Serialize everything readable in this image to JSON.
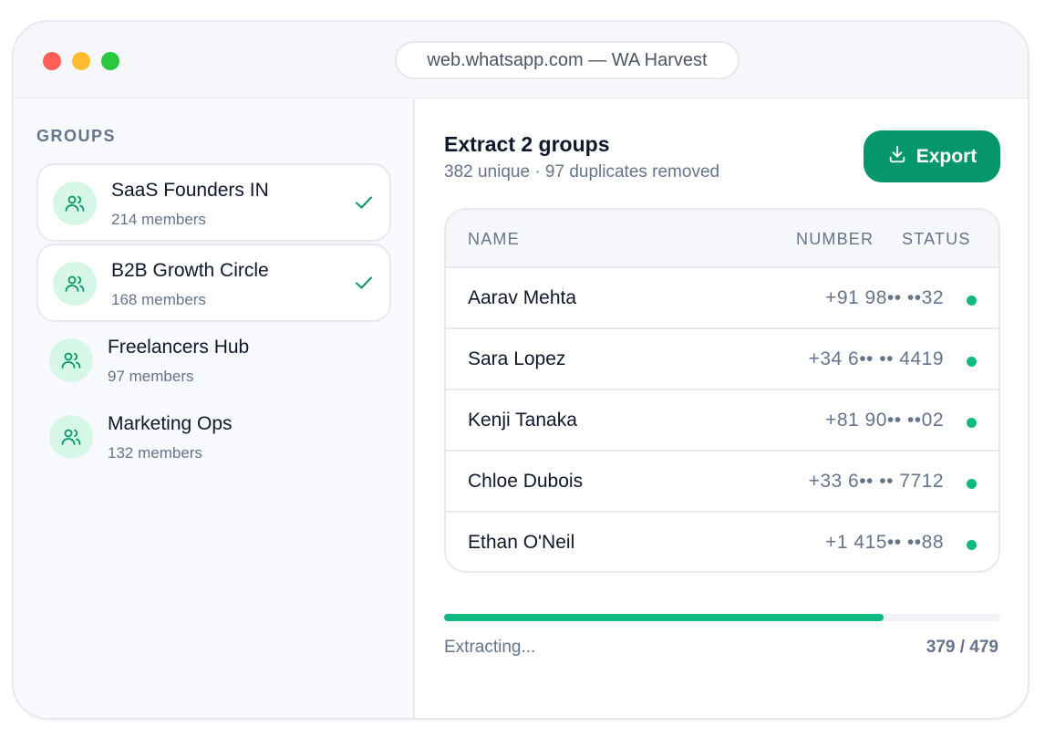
{
  "window": {
    "url_label": "web.whatsapp.com — WA Harvest"
  },
  "sidebar": {
    "title": "GROUPS",
    "groups": [
      {
        "name": "SaaS Founders IN",
        "count": "214 members",
        "selected": true,
        "icon": "users-icon"
      },
      {
        "name": "B2B Growth Circle",
        "count": "168 members",
        "selected": true,
        "icon": "users-icon"
      },
      {
        "name": "Freelancers Hub",
        "count": "97 members",
        "selected": false,
        "icon": "users-icon"
      },
      {
        "name": "Marketing Ops",
        "count": "132 members",
        "selected": false,
        "icon": "users-icon"
      }
    ]
  },
  "main": {
    "title": "Extract 2 groups",
    "subtitle": "382 unique · 97 duplicates removed",
    "export_label": "Export",
    "export_icon": "download-icon",
    "table": {
      "headers": {
        "name": "NAME",
        "number": "NUMBER",
        "status": "STATUS"
      },
      "rows": [
        {
          "name": "Aarav Mehta",
          "number": "+91 98•• ••32",
          "status_color": "#10b981"
        },
        {
          "name": "Sara Lopez",
          "number": "+34 6•• •• 4419",
          "status_color": "#10b981"
        },
        {
          "name": "Kenji Tanaka",
          "number": "+81 90•• ••02",
          "status_color": "#10b981"
        },
        {
          "name": "Chloe Dubois",
          "number": "+33 6•• •• 7712",
          "status_color": "#10b981"
        },
        {
          "name": "Ethan O'Neil",
          "number": "+1 415•• ••88",
          "status_color": "#10b981"
        }
      ]
    },
    "progress": {
      "label": "Extracting...",
      "count_text": "379 / 479",
      "fraction": 0.79
    }
  },
  "colors": {
    "accent": "#059669",
    "progress": "#10b981",
    "avatar_bg": "#d6f7e7"
  }
}
